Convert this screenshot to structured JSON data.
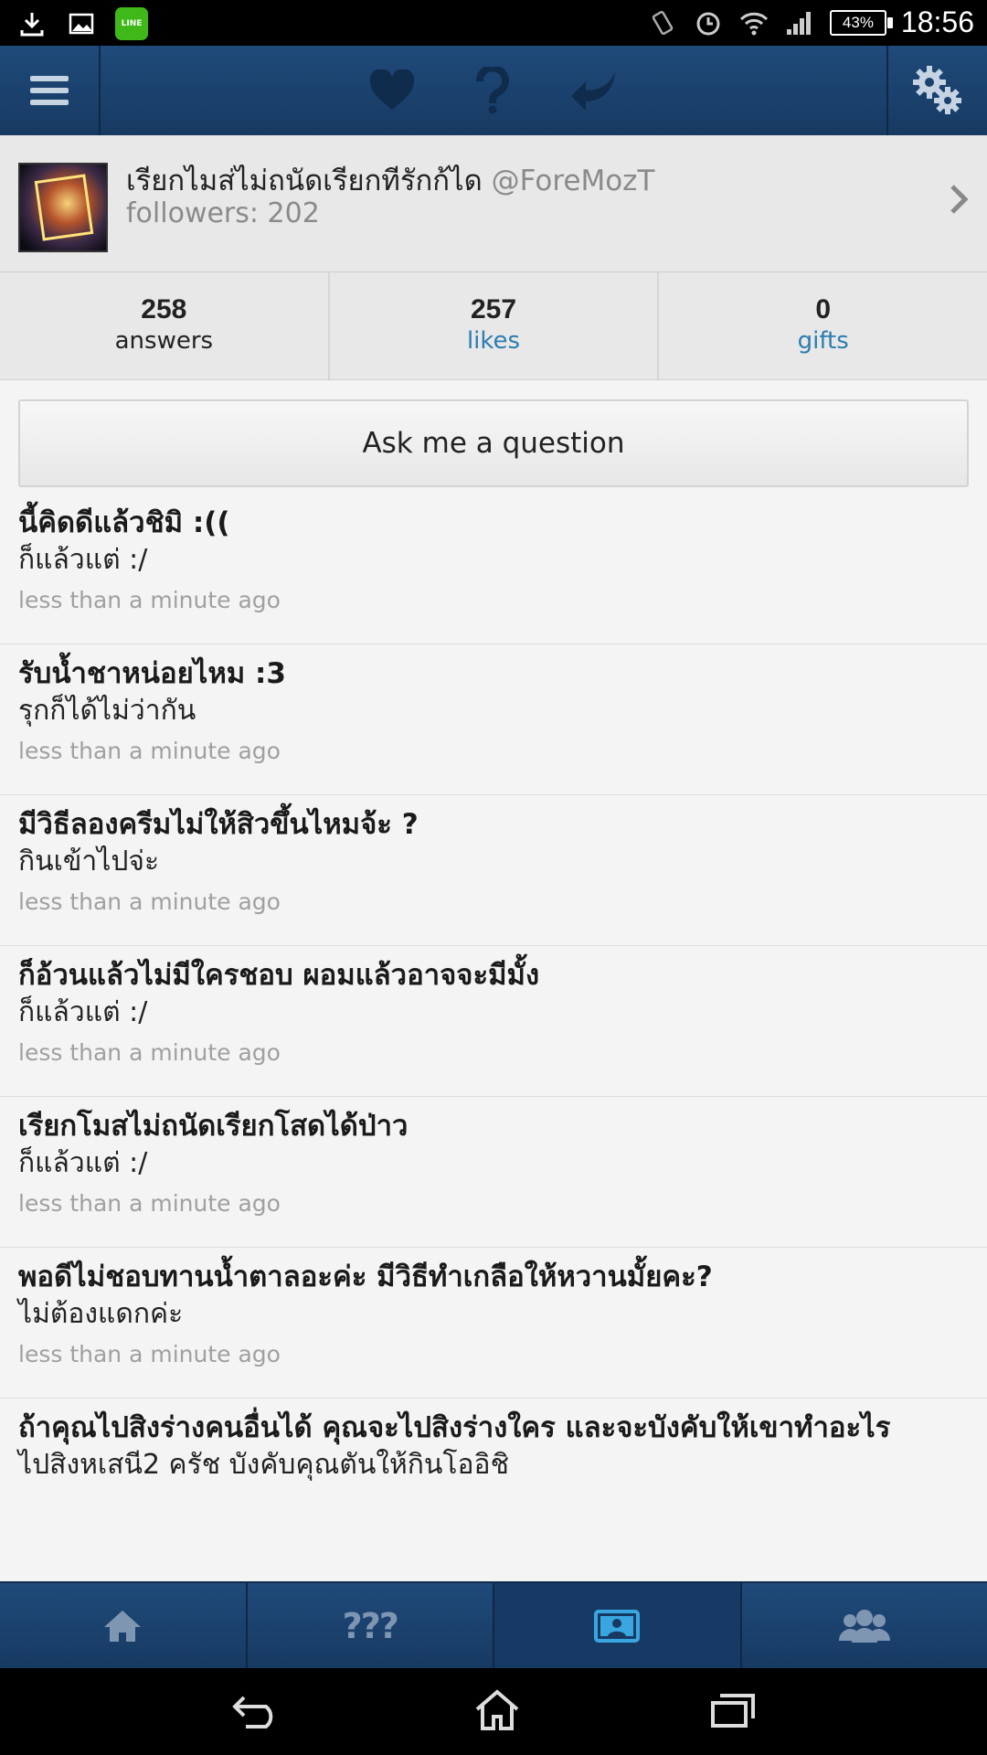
{
  "status_bar": {
    "battery": "43%",
    "time": "18:56",
    "line_label": "LINE"
  },
  "profile": {
    "name": "เรียกไมส่ไม่ถนัดเรียกทีรักก้ได",
    "handle": "@ForeMozT",
    "followers": "followers: 202"
  },
  "stats": [
    {
      "value": "258",
      "label": "answers"
    },
    {
      "value": "257",
      "label": "likes"
    },
    {
      "value": "0",
      "label": "gifts"
    }
  ],
  "ask_button": "Ask me a question",
  "feed": [
    {
      "question": "นี้คิดดีแล้วชิมิ :((",
      "answer": "ก็แล้วแต่ :/",
      "time": "less than a minute ago"
    },
    {
      "question": "รับน้ำชาหน่อยไหม :3",
      "answer": "รุกก็ได้ไม่ว่ากัน",
      "time": "less than a minute ago"
    },
    {
      "question": "มีวิธีลองครีมไม่ให้สิวขึ้นไหมจ้ะ ?",
      "answer": "กินเข้าไปจ่ะ",
      "time": "less than a minute ago"
    },
    {
      "question": "ก็อ้วนแล้วไม่มีใครชอบ ผอมแล้วอาจจะมีมั้ง",
      "answer": "ก็แล้วแต่ :/",
      "time": "less than a minute ago"
    },
    {
      "question": "เรียกโมสไม่ถนัดเรียกโสดได้ป่าว",
      "answer": "ก็แล้วแต่ :/",
      "time": "less than a minute ago"
    },
    {
      "question": "พอดีไม่ชอบทานน้ำตาลอะค่ะ มีวิธีทำเกลือให้หวานมั้ยคะ?",
      "answer": "ไม่ต้องแดกค่ะ",
      "time": "less than a minute ago"
    },
    {
      "question": "ถ้าคุณไปสิงร่างคนอื่นได้ คุณจะไปสิงร่างใคร และจะบังคับให้เขาทำอะไร",
      "answer": "ไปสิงหเสนี2 ครัช บังคับคุณตันให้กินโออิชิ",
      "time": ""
    }
  ],
  "tabs": {
    "questions_label": "???"
  },
  "colors": {
    "bar_blue": "#1f4a7a",
    "link_blue": "#2d7db0",
    "active_tab_icon": "#3aa6e0"
  }
}
